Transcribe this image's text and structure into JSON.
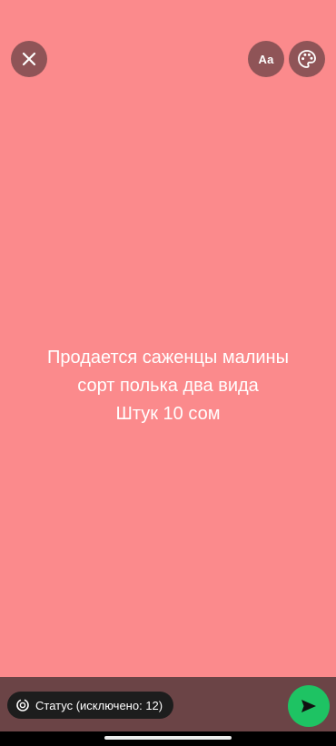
{
  "toolbar": {
    "font_button_label": "Aa"
  },
  "status": {
    "text": "Продается саженцы малины\nсорт полька два вида\nШтук 10  сом",
    "background_color": "#fb8a8c"
  },
  "footer": {
    "privacy_label": "Статус (исключено: 12)",
    "send_button_color": "#1ec363"
  },
  "icons": {
    "close": "close-icon",
    "palette": "palette-icon",
    "privacy": "status-privacy-icon",
    "send": "send-icon"
  }
}
